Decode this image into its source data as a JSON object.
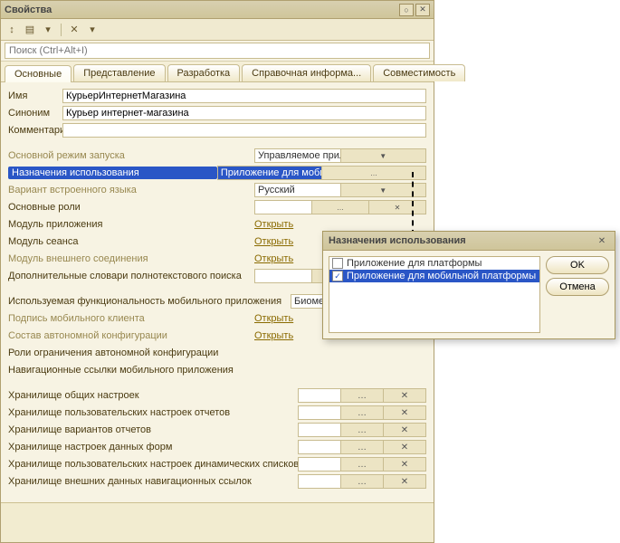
{
  "panel": {
    "title": "Свойства"
  },
  "search": {
    "placeholder": "Поиск (Ctrl+Alt+I)"
  },
  "tabs": [
    "Основные",
    "Представление",
    "Разработка",
    "Справочная информа...",
    "Совместимость"
  ],
  "fields": {
    "name_lbl": "Имя",
    "name_val": "КурьерИнтернетМагазина",
    "syn_lbl": "Синоним",
    "syn_val": "Курьер интернет-магазина",
    "com_lbl": "Комментарий",
    "com_val": "",
    "mode_lbl": "Основной режим запуска",
    "mode_val": "Управляемое приложение",
    "usage_lbl": "Назначения использования",
    "usage_val": "Приложение для мобильной платформы",
    "lang_lbl": "Вариант встроенного языка",
    "lang_val": "Русский",
    "roles_lbl": "Основные роли",
    "roles_val": "",
    "appmod_lbl": "Модуль приложения",
    "open": "Открыть",
    "sessmod_lbl": "Модуль сеанса",
    "extmod_lbl": "Модуль внешнего соединения",
    "dict_lbl": "Дополнительные словари полнотекстового поиска",
    "mobfunc_lbl": "Используемая функциональность мобильного приложения",
    "mobfunc_val": "Биометрия",
    "sign_lbl": "Подпись мобильного клиента",
    "auto_lbl": "Состав автономной конфигурации",
    "roles2_lbl": "Роли ограничения автономной конфигурации",
    "nav_lbl": "Навигационные ссылки мобильного приложения",
    "st1": "Хранилище общих настроек",
    "st2": "Хранилище пользовательских настроек отчетов",
    "st3": "Хранилище вариантов отчетов",
    "st4": "Хранилище настроек данных форм",
    "st5": "Хранилище пользовательских настроек динамических списков",
    "st6": "Хранилище внешних данных навигационных ссылок"
  },
  "popup": {
    "title": "Назначения использования",
    "opt1": "Приложение для платформы",
    "opt2": "Приложение для мобильной платформы",
    "ok": "OK",
    "cancel": "Отмена"
  }
}
